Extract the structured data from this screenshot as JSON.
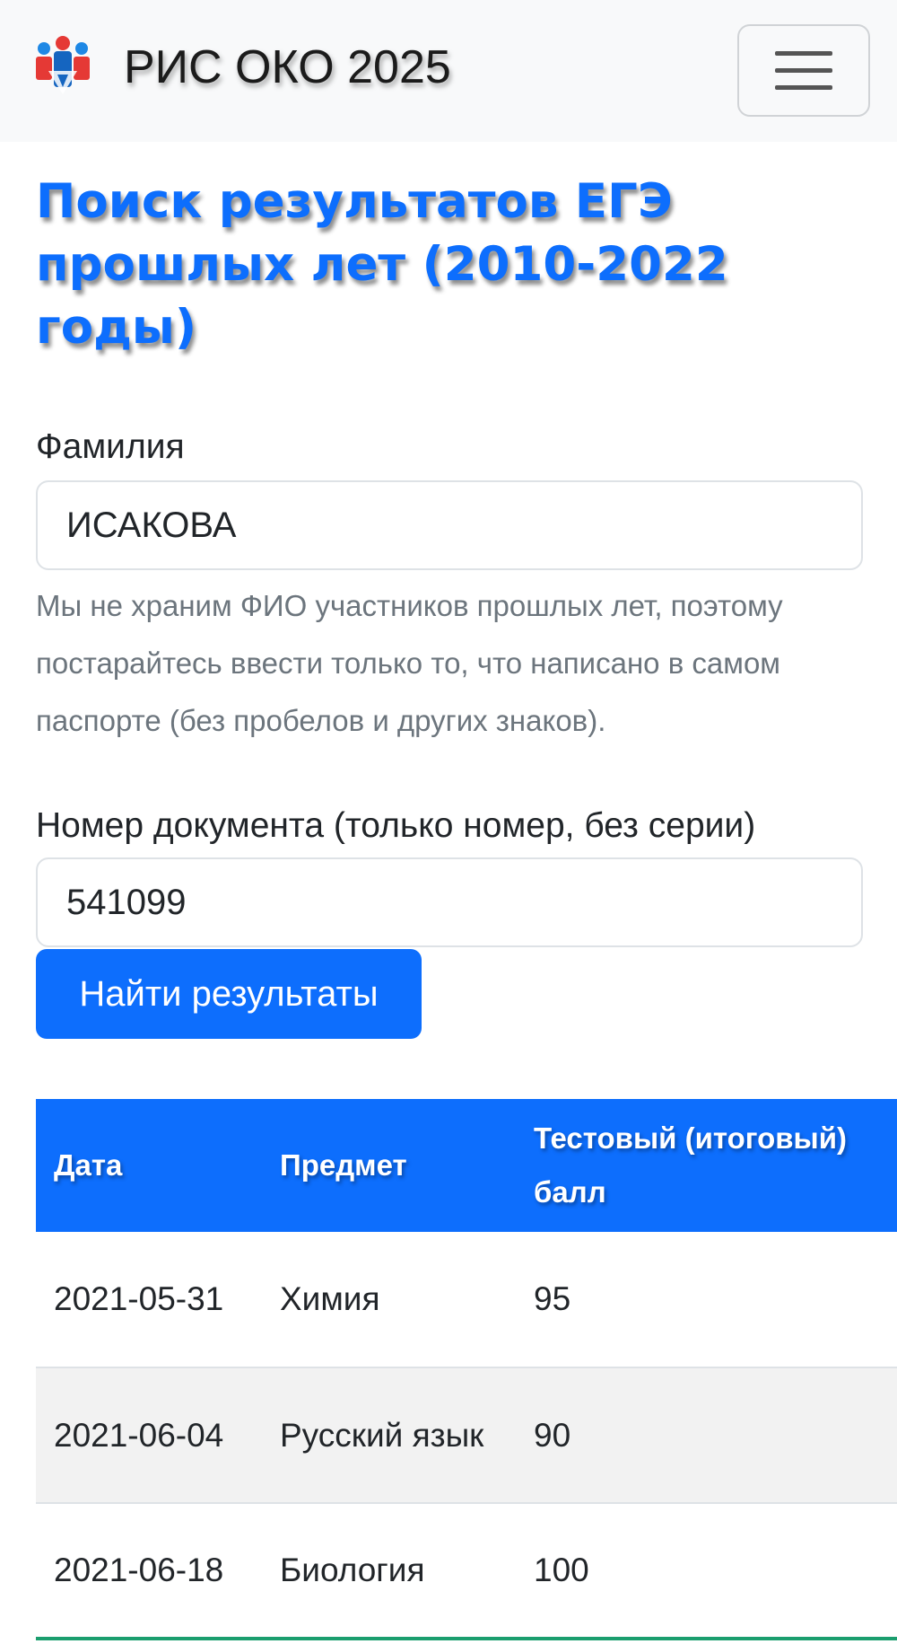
{
  "header": {
    "brand_text": "РИС ОКО 2025",
    "logo_icon": "ege-people-logo-icon",
    "menu_icon": "hamburger-menu-icon"
  },
  "colors": {
    "accent": "#0d6efd",
    "navbar_bg": "#f8f9fa",
    "help_text": "#6c757d",
    "row_stripe": "#f2f2f2",
    "table_bottom_border": "#1b9e6e"
  },
  "page": {
    "title": "Поиск результатов ЕГЭ прошлых лет (2010-2022 годы)"
  },
  "form": {
    "surname_label": "Фамилия",
    "surname_value": "ИСАКОВА",
    "surname_help": "Мы не храним ФИО участников прошлых лет, поэтому постарайтесь ввести только то, что написано в самом паспорте (без пробелов и других знаков).",
    "doc_label": "Номер документа (только номер, без серии)",
    "doc_value": "541099",
    "submit_label": "Найти результаты"
  },
  "results": {
    "columns": [
      "Дата",
      "Предмет",
      "Тестовый (итоговый) балл"
    ],
    "rows": [
      {
        "date": "2021-05-31",
        "subject": "Химия",
        "score": "95"
      },
      {
        "date": "2021-06-04",
        "subject": "Русский язык",
        "score": "90"
      },
      {
        "date": "2021-06-18",
        "subject": "Биология",
        "score": "100"
      }
    ]
  }
}
